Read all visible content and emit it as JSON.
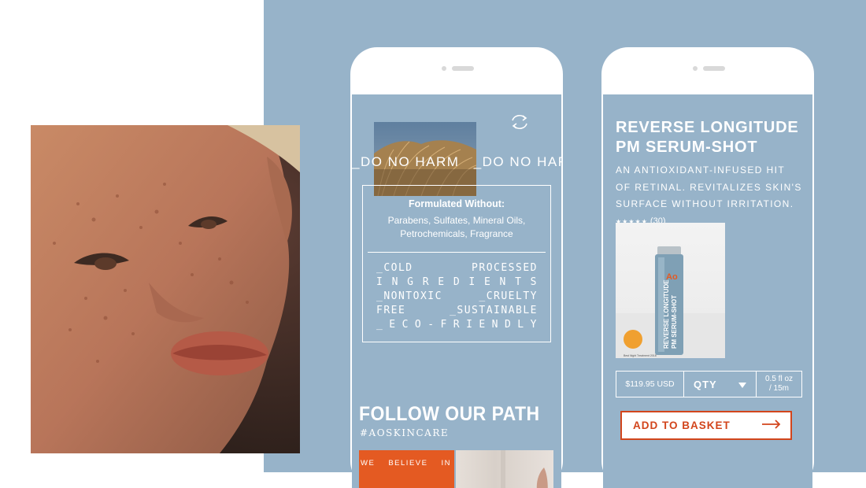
{
  "phone1": {
    "marquee": [
      "_DO NO HARM",
      "_DO NO HARM"
    ],
    "formulated_title": "Formulated Without:",
    "formulated_lines": [
      "Parabens, Sulfates, Mineral Oils,",
      "Petrochemicals, Fragrance"
    ],
    "tags": [
      [
        "_COLD",
        "PROCESSED"
      ],
      [
        "I",
        "N",
        "G",
        "R",
        "E",
        "D",
        "I",
        "E",
        "N",
        "T",
        "S"
      ],
      [
        "_NONTOXIC",
        "_CRUELTY"
      ],
      [
        "FREE",
        "_SUSTAINABLE"
      ],
      [
        "_",
        "E",
        "C",
        "O",
        "-",
        "F",
        "R",
        "I",
        "E",
        "N",
        "D",
        "L",
        "Y"
      ]
    ],
    "follow_title": "FOLLOW OUR PATH",
    "hashtag": "#AOSKINCARE",
    "tile_words": [
      "WE",
      "BELIEVE",
      "IN"
    ]
  },
  "phone2": {
    "title_line1": "REVERSE LONGITUDE",
    "title_line2": "PM SERUM-SHOT",
    "desc_line1": "AN ANTIOXIDANT-INFUSED HIT",
    "desc_line2": "OF RETINAL. REVITALIZES SKIN'S",
    "desc_line3": "SURFACE WITHOUT IRRITATION.",
    "stars": "★★★★★",
    "review_count": "(30)",
    "bottle_text_1": "REVERSE LONGITUDE",
    "bottle_text_2": "PM SERUM-SHOT",
    "bottle_logo": "Ao",
    "award_caption": "Best Night Treatment 2018",
    "price": "$119.95 USD",
    "qty_label": "QTY",
    "size_line1": "0.5 fl oz",
    "size_line2": "/ 15m",
    "add_to_basket": "ADD TO BASKET"
  },
  "colors": {
    "panel_blue": "#97b3c9",
    "accent_orange": "#e45a22",
    "button_red": "#d2451c"
  }
}
